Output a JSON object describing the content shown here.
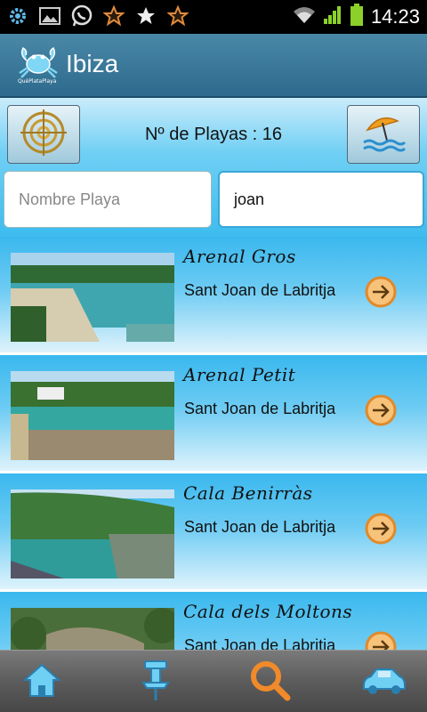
{
  "status_bar": {
    "icons": [
      "settings-gear-icon",
      "picture-icon",
      "whatsapp-icon",
      "star-orange-icon",
      "star-white-icon",
      "star-orange-icon"
    ],
    "time": "14:23"
  },
  "action_bar": {
    "logo_text": "QuéPlataPlaya",
    "title": "Ibiza"
  },
  "controls": {
    "count_label": "Nº de Playas : 16",
    "name_placeholder": "Nombre Playa",
    "town_value": "joan"
  },
  "beaches": [
    {
      "name": "Arenal Gros",
      "town": "Sant Joan de Labritja"
    },
    {
      "name": "Arenal Petit",
      "town": "Sant Joan de Labritja"
    },
    {
      "name": "Cala Benirràs",
      "town": "Sant Joan de Labritja"
    },
    {
      "name": "Cala dels Moltons",
      "town": "Sant Joan de Labritja"
    }
  ],
  "bottom_nav": [
    "home-icon",
    "pin-icon",
    "search-icon",
    "car-icon"
  ],
  "colors": {
    "accent": "#3dbcef",
    "action_bar": "#2d6a8d",
    "arrow_button": "#f2a24a"
  }
}
